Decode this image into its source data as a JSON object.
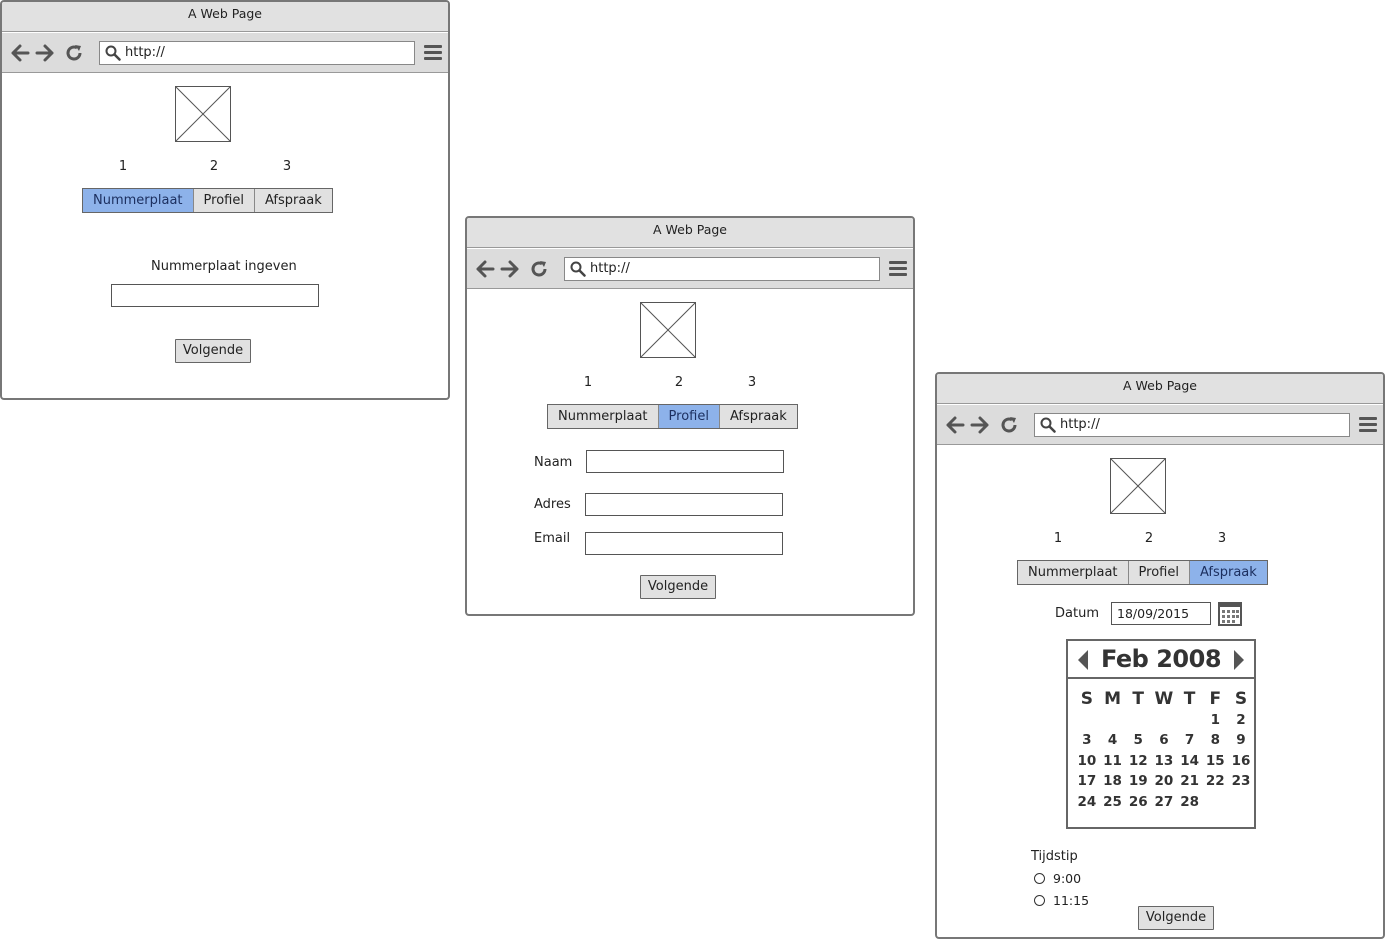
{
  "browser": {
    "title": "A Web Page",
    "url": "http://"
  },
  "steps": [
    "1",
    "2",
    "3"
  ],
  "tabs": [
    "Nummerplaat",
    "Profiel",
    "Afspraak"
  ],
  "screen1": {
    "active_tab": 0,
    "prompt": "Nummerplaat ingeven",
    "plate_value": "",
    "next_button": "Volgende"
  },
  "screen2": {
    "active_tab": 1,
    "fields": [
      {
        "label": "Naam",
        "value": ""
      },
      {
        "label": "Adres",
        "value": ""
      },
      {
        "label": "Email",
        "value": ""
      }
    ],
    "next_button": "Volgende"
  },
  "screen3": {
    "active_tab": 2,
    "date_label": "Datum",
    "date_value": "18/09/2015",
    "calendar": {
      "month_title": "Feb 2008",
      "weekdays": [
        "S",
        "M",
        "T",
        "W",
        "T",
        "F",
        "S"
      ],
      "leading_blank_days": 5,
      "days": [
        "1",
        "2",
        "3",
        "4",
        "5",
        "6",
        "7",
        "8",
        "9",
        "10",
        "11",
        "12",
        "13",
        "14",
        "15",
        "16",
        "17",
        "18",
        "19",
        "20",
        "21",
        "22",
        "23",
        "24",
        "25",
        "26",
        "27",
        "28"
      ]
    },
    "time_label": "Tijdstip",
    "time_options": [
      "9:00",
      "11:15"
    ],
    "next_button": "Volgende"
  },
  "colors": {
    "active_tab": "#8db2ea",
    "chrome": "#dcdcdc",
    "border": "#777777"
  }
}
